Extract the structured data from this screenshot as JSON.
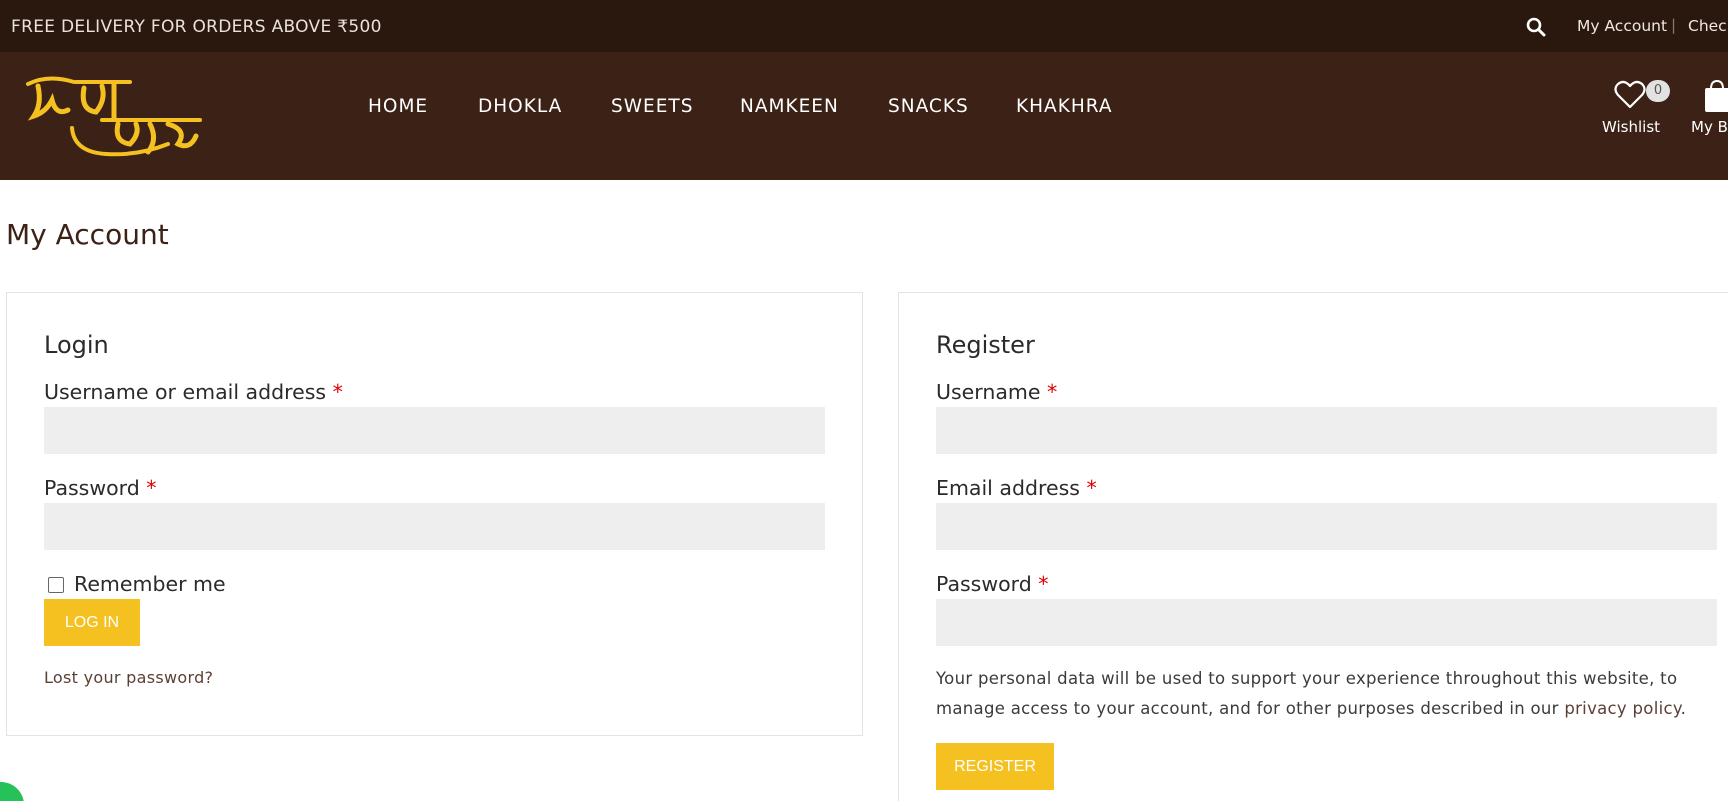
{
  "topbar": {
    "promo": "FREE DELIVERY FOR ORDERS ABOVE ₹500",
    "search_icon": "search-icon",
    "links": [
      "My Account",
      "Check"
    ],
    "separator": "|"
  },
  "header": {
    "logo_icon": "brand-logo",
    "nav": [
      "HOME",
      "DHOKLA",
      "SWEETS",
      "NAMKEEN",
      "SNACKS",
      "KHAKHRA"
    ],
    "wishlist": {
      "icon": "heart-icon",
      "count": "0",
      "label": "Wishlist"
    },
    "bag": {
      "icon": "shopping-bag-icon",
      "label": "My Ba"
    }
  },
  "page": {
    "title": "My Account"
  },
  "login": {
    "heading": "Login",
    "username_label": "Username or email address",
    "password_label": "Password",
    "required_mark": "*",
    "username_value": "",
    "password_value": "",
    "remember_label": "Remember me",
    "remember_checked": false,
    "button": "LOG IN",
    "lost_password": "Lost your password?"
  },
  "register": {
    "heading": "Register",
    "username_label": "Username",
    "email_label": "Email address",
    "password_label": "Password",
    "required_mark": "*",
    "username_value": "",
    "email_value": "",
    "password_value": "",
    "privacy_text": "Your personal data will be used to support your experience throughout this website, to manage access to your account, and for other purposes described in our",
    "privacy_link": "privacy policy",
    "privacy_end": ".",
    "button": "REGISTER"
  },
  "colors": {
    "topbar_bg": "#2a180f",
    "header_bg": "#3b2116",
    "accent": "#f5c121",
    "required": "#e00000",
    "input_bg": "#eeeeee",
    "chat": "#27c15a"
  }
}
